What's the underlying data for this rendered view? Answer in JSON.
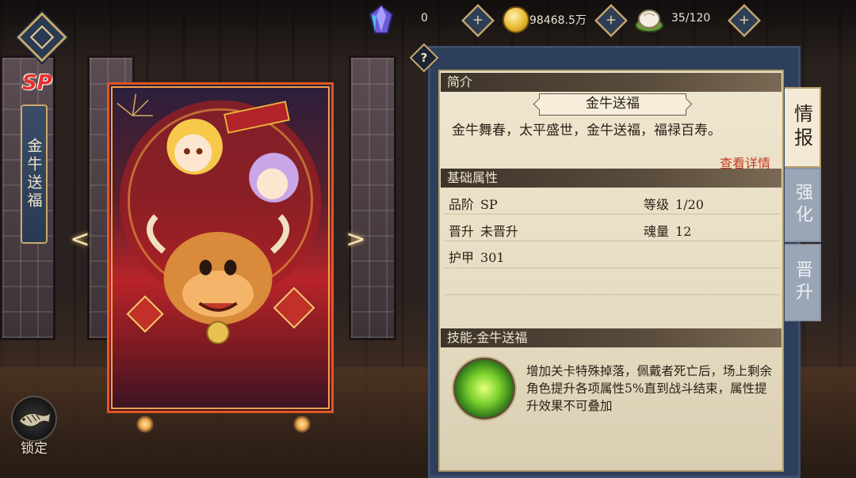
{
  "topbar": {
    "gem_count": "0",
    "gold_amount": "98468.5万",
    "stamina": "35/120",
    "plus_label": "+"
  },
  "character": {
    "rarity": "SP",
    "name": "金牛送福",
    "lock_label": "锁定",
    "prev_arrow": "<",
    "next_arrow": ">"
  },
  "panel": {
    "help_label": "?",
    "intro_header": "简介",
    "title": "金牛送福",
    "description": "金牛舞春，太平盛世，金牛送福，福禄百寿。",
    "details_link": "查看详情",
    "attributes_header": "基础属性",
    "stats": [
      {
        "key": "品阶",
        "value": "SP"
      },
      {
        "key": "等级",
        "value": "1/20"
      },
      {
        "key": "晋升",
        "value": "未晋升"
      },
      {
        "key": "魂量",
        "value": "12"
      },
      {
        "key": "护甲",
        "value": "301"
      }
    ],
    "skill_header": "技能-金牛送福",
    "skill_description": "增加关卡特殊掉落，佩戴者死亡后，场上剩余角色提升各项属性5%直到战斗结束，属性提升效果不可叠加"
  },
  "tabs": [
    {
      "label": "情报",
      "active": true
    },
    {
      "label": "强化",
      "active": false
    },
    {
      "label": "晋升",
      "active": false
    }
  ],
  "colors": {
    "accent_gold": "#c9a86a",
    "panel_navy": "#2d3f5a",
    "paper": "#efe6cf",
    "link_red": "#c53b1f",
    "card_frame": "#e3561f"
  },
  "icons": {
    "back": "diamond-back-icon",
    "gem": "crystal-icon",
    "gold": "gold-ingot-icon",
    "stamina": "bun-steamer-icon",
    "lock": "koi-fish-icon",
    "skill": "green-aura-icon"
  }
}
